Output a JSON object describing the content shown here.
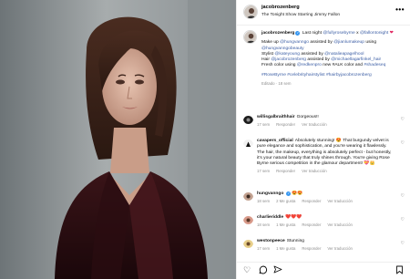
{
  "post": {
    "username": "jacobrozenberg",
    "subtitle": "The Tonight Show Starring Jimmy Fallon",
    "more_label": "•••"
  },
  "caption": {
    "username": "jacobrozenberg",
    "line1_a": "Last night",
    "line1_tag1": "@fullyrosebyrne",
    "line1_x": "x",
    "line1_tag2": "@fallontonight",
    "line1_emoji": "❤",
    "makeup_a": "Make up",
    "makeup_tag": "@hungvanngo",
    "makeup_b": "assisted by",
    "makeup_tag2": "@jianlumakeup",
    "makeup_c": "using",
    "makeup_brand": "@hungvanngobeauty",
    "stylist_a": "Stylist",
    "stylist_tag": "@kateyoung",
    "stylist_b": "assisted by",
    "stylist_tag2": "@natalieapagelhool",
    "hair_a": "Hair",
    "hair_tag": "@jacobrozenberg",
    "hair_b": "assisted by",
    "hair_tag2": "@michaellagarfinkel_hair",
    "color_a": "Fresh color using",
    "color_tag": "@redkenpro",
    "color_b": "new #ALK color and",
    "color_tag2": "#shadeseq",
    "hashtags": "#RoseByrne #celebrityhairstylist #hairbyjacobrozenberg",
    "edited": "Editado · 18 sem"
  },
  "comments": [
    {
      "user": "willisgalbraithhair",
      "text": "Gorgeous!!",
      "time": "17 sem",
      "likes": "",
      "reply": "Responder",
      "translate": "Ver traducción"
    },
    {
      "user": "cavapers_official",
      "text": "Absolutely stunning! 😍 That burgundy velvet is pure elegance and sophistication, and you're wearing it flawlessly. The hair, the makeup, everything is absolutely perfect - but honestly, it's your natural beauty that truly shines through. You're giving Rose Byrne serious competition in the glamour department! 💝👑",
      "time": "17 sem",
      "likes": "",
      "reply": "Responder",
      "translate": "Ver traducción"
    },
    {
      "user": "hungvanngo",
      "text": "😍😍",
      "time": "18 sem",
      "likes": "2 Me gusta",
      "reply": "Responder",
      "translate": "Ver traducción"
    },
    {
      "user": "charlieriddle",
      "text": "❤️❤️❤️",
      "time": "18 sem",
      "likes": "1 Me gusta",
      "reply": "Responder",
      "translate": "Ver traducción"
    },
    {
      "user": "westonpeece",
      "text": "Stunning",
      "time": "17 sem",
      "likes": "1 Me gusta",
      "reply": "Responder",
      "translate": "Ver traducción"
    }
  ],
  "actions": {
    "like_icon": "heart-outline-icon",
    "comment_icon": "comment-icon",
    "share_icon": "share-icon",
    "save_icon": "bookmark-icon"
  },
  "colors": {
    "link": "#3d5fa5",
    "verified": "#3897f0",
    "meta": "#8e8e8e"
  }
}
